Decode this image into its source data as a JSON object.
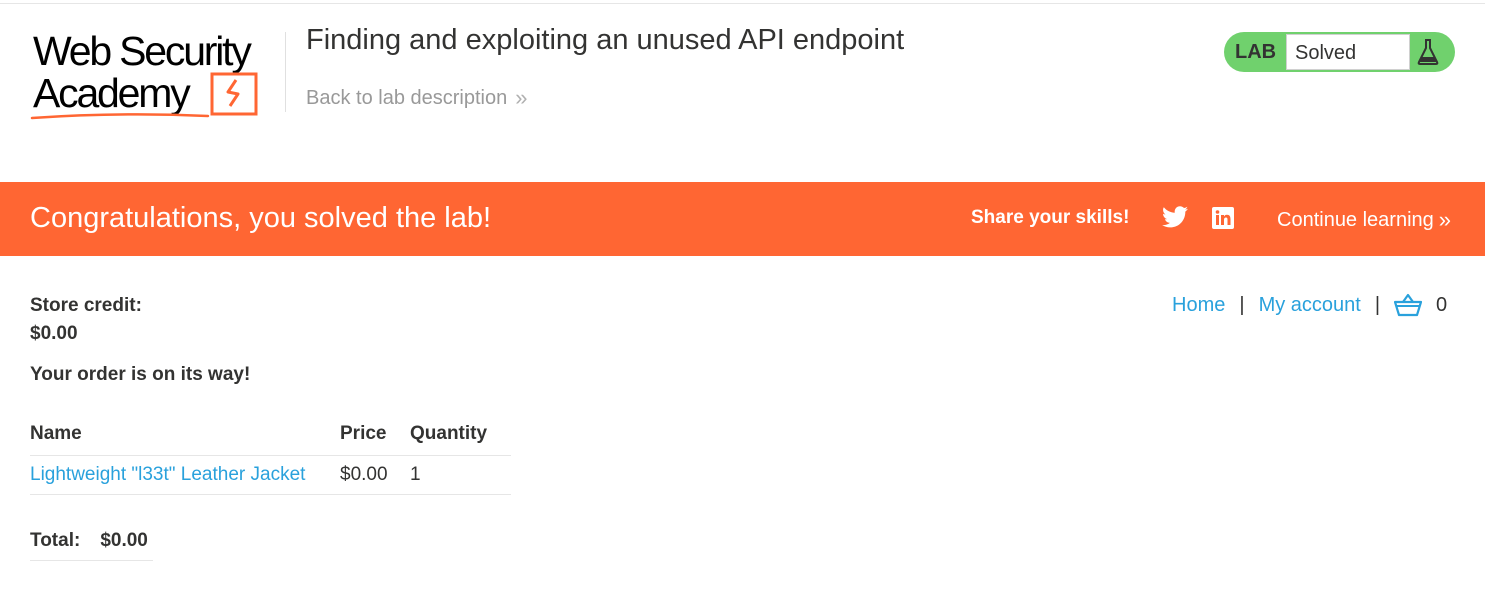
{
  "header": {
    "logo": {
      "line1": "Web Security",
      "line2": "Academy"
    },
    "lab_title": "Finding and exploiting an unused API endpoint",
    "back_link": "Back to lab description",
    "status": {
      "label": "LAB",
      "value": "Solved",
      "icon": "flask-icon",
      "color": "#70d16d"
    }
  },
  "banner": {
    "message": "Congratulations, you solved the lab!",
    "share_label": "Share your skills!",
    "share_icons": [
      "twitter-icon",
      "linkedin-icon"
    ],
    "continue_label": "Continue learning",
    "color": "#ff6633"
  },
  "nav": {
    "home": "Home",
    "separator": "|",
    "my_account": "My account",
    "cart_icon": "basket-icon",
    "cart_count": "0",
    "link_color": "#29a1dc"
  },
  "account": {
    "credit_label": "Store credit:",
    "credit_value": "$0.00",
    "order_message": "Your order is on its way!"
  },
  "order": {
    "columns": [
      "Name",
      "Price",
      "Quantity"
    ],
    "rows": [
      {
        "name": "Lightweight \"l33t\" Leather Jacket",
        "price": "$0.00",
        "quantity": "1"
      }
    ],
    "total_label": "Total:",
    "total_value": "$0.00"
  }
}
